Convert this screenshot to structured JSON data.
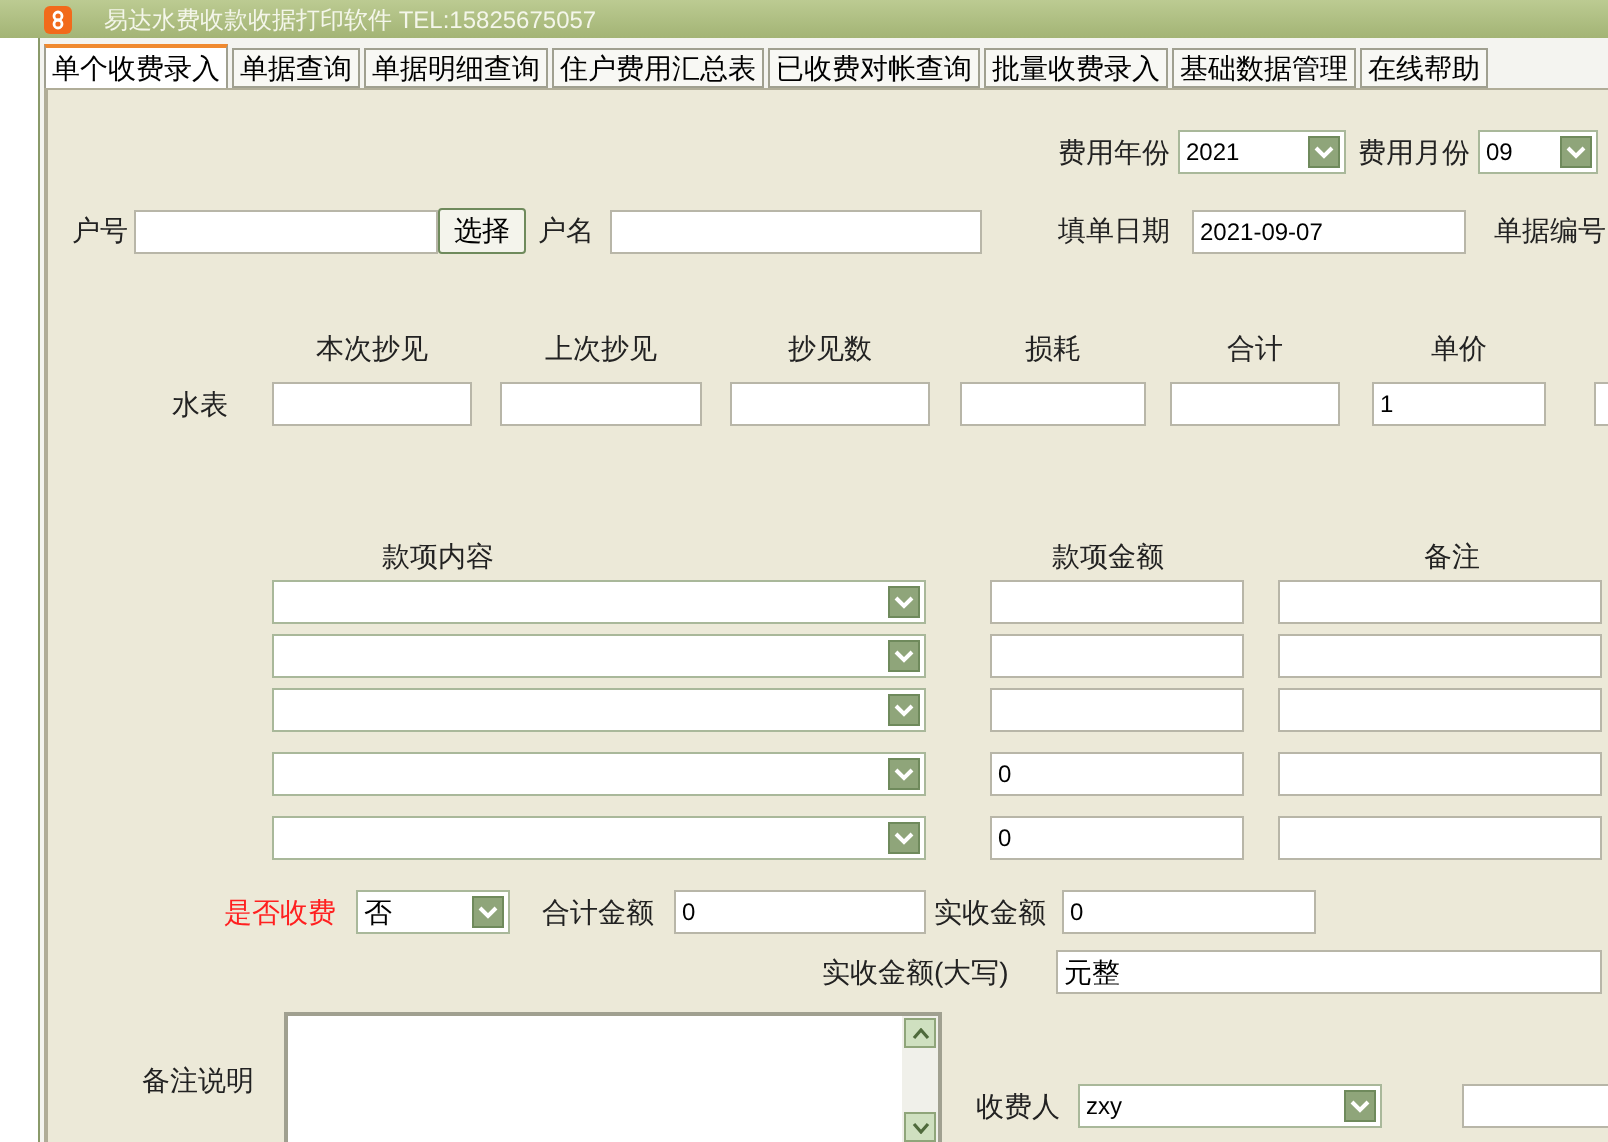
{
  "window": {
    "title": "易达水费收款收据打印软件 TEL:15825675057"
  },
  "tabs": [
    {
      "label": "单个收费录入",
      "selected": true
    },
    {
      "label": "单据查询",
      "selected": false
    },
    {
      "label": "单据明细查询",
      "selected": false
    },
    {
      "label": "住户费用汇总表",
      "selected": false
    },
    {
      "label": "已收费对帐查询",
      "selected": false
    },
    {
      "label": "批量收费录入",
      "selected": false
    },
    {
      "label": "基础数据管理",
      "selected": false
    },
    {
      "label": "在线帮助",
      "selected": false
    }
  ],
  "period": {
    "year_label": "费用年份",
    "year": "2021",
    "month_label": "费用月份",
    "month": "09"
  },
  "account": {
    "number_label": "户号",
    "select_button": "选择",
    "name_label": "户名",
    "date_label": "填单日期",
    "date": "2021-09-07",
    "bill_no_label": "单据编号"
  },
  "meter": {
    "row_label": "水表",
    "columns": [
      {
        "label": "本次抄见"
      },
      {
        "label": "上次抄见"
      },
      {
        "label": "抄见数"
      },
      {
        "label": "损耗"
      },
      {
        "label": "合计"
      },
      {
        "label": "单价",
        "value": "1"
      }
    ]
  },
  "items": {
    "headers": [
      "款项内容",
      "款项金额",
      "备注"
    ],
    "rows": [
      {
        "amount": null
      },
      {
        "amount": null
      },
      {
        "amount": null
      },
      {
        "amount": "0"
      },
      {
        "amount": "0"
      }
    ]
  },
  "payment": {
    "charged_label": "是否收费",
    "charged": "否",
    "total_label": "合计金额",
    "total": "0",
    "received_label": "实收金额",
    "received": "0",
    "in_words_label": "实收金额(大写)",
    "in_words": "元整"
  },
  "note_label": "备注说明",
  "collector": {
    "label": "收费人",
    "value": "zxy"
  }
}
